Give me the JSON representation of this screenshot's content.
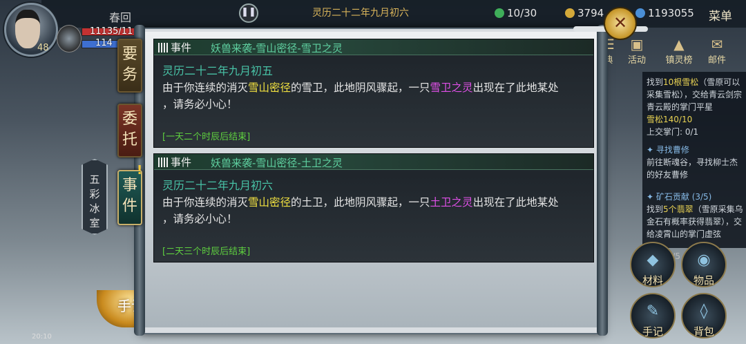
{
  "hud": {
    "level": "48",
    "hp": "11135/11",
    "mp": "114",
    "season": "春回",
    "date": "灵历二十二年九月初六",
    "stamina": "10/30",
    "coins": "3794",
    "spirit_stones": "1193055",
    "menu_label": "菜单",
    "time": "20:10"
  },
  "right_tabs": [
    "典",
    "活动",
    "镇灵榜",
    "邮件"
  ],
  "quests": [
    {
      "pre": "找到",
      "hl": "10根雪松",
      "rest": "（雪原可以采集雪松），交给青云剑宗青云殿的掌门平星",
      "progress1": "雪松140/10",
      "progress2": "上交掌门: 0/1"
    },
    {
      "title": "寻找曹修",
      "body": "前往断魂谷，寻找柳士杰的好友曹修"
    },
    {
      "title": "矿石贡献 (3/5)",
      "pre": "找到",
      "hl": "5个翡翠",
      "rest": "（雪原采集乌金石有概率获得翡翠），交给凌霄山的掌门虚弦"
    }
  ],
  "right_buttons": [
    "材料",
    "物品",
    "手记",
    "背包"
  ],
  "right_count": "49/5",
  "left_tabs": [
    "要务",
    "委托",
    "事件"
  ],
  "location": "五彩冰室",
  "shouji_label": "手记",
  "events": [
    {
      "tag": "事件",
      "title": "妖兽来袭-雪山密径-雪卫之灵",
      "date": "灵历二十二年九月初五",
      "t1": "由于你连续的消灭",
      "place": "雪山密径",
      "t2": "的雪卫，此地阴风骤起，一只",
      "monster": "雪卫之灵",
      "t3": "出现在了此地某处",
      "t4": "，请务必小心！",
      "end": "[一天二个时辰后结束]"
    },
    {
      "tag": "事件",
      "title": "妖兽来袭-雪山密径-土卫之灵",
      "date": "灵历二十二年九月初六",
      "t1": "由于你连续的消灭",
      "place": "雪山密径",
      "t2": "的土卫，此地阴风骤起，一只",
      "monster": "土卫之灵",
      "t3": "出现在了此地某处",
      "t4": "，请务必小心！",
      "end": "[二天三个时辰后结束]"
    }
  ]
}
